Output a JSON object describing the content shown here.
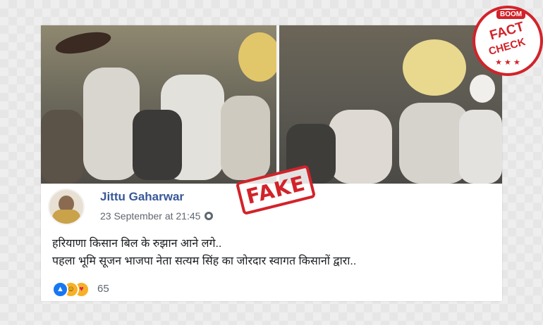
{
  "post": {
    "author_name": "Jittu Gaharwar",
    "timestamp": "23 September at 21:45",
    "privacy_icon": "globe-icon",
    "text_line_1": "हरियाणा किसान बिल के रुझान आने लगे..",
    "text_line_2": "पहला भूमि सूजन भाजपा नेता सत्यम सिंह का जोरदार स्वागत किसानों द्वारा..",
    "reaction_icons": [
      "like-icon",
      "haha-icon",
      "care-icon"
    ],
    "reaction_count": "65"
  },
  "stamp": {
    "fake_label": "FAKE",
    "badge_brand": "BOOM",
    "badge_line_1": "FACT",
    "badge_line_2": "CHECK",
    "badge_stars": "★ ★ ★"
  },
  "colors": {
    "name_blue": "#385898",
    "stamp_red": "#d2232a",
    "like_blue": "#1877f2",
    "haha_yellow": "#f7b125"
  }
}
